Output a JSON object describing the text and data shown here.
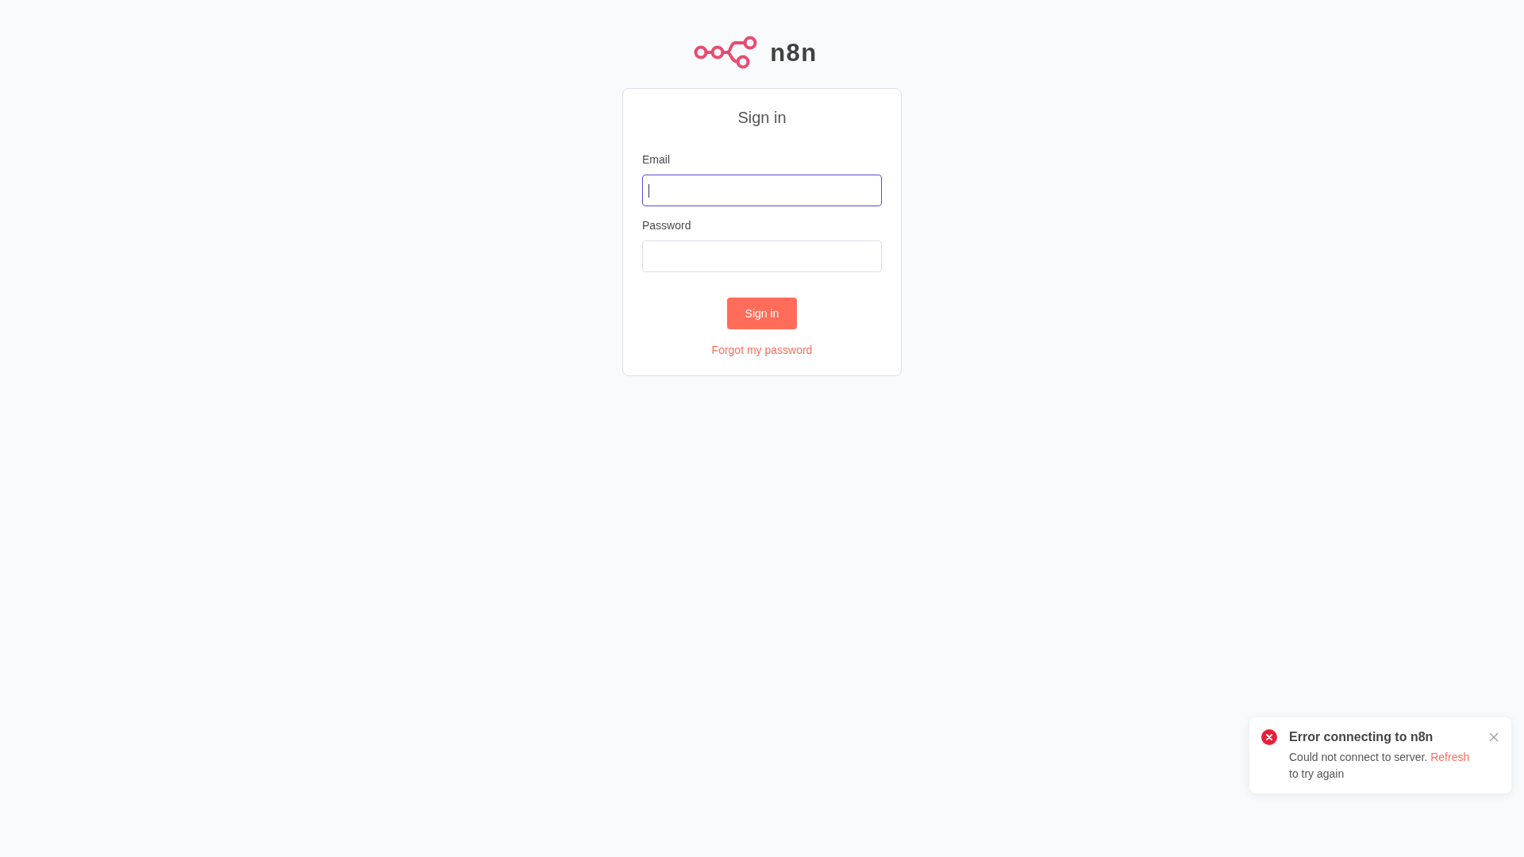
{
  "logo": {
    "wordmark": "n8n"
  },
  "sign_in": {
    "title": "Sign in",
    "fields": [
      {
        "label": "Email",
        "focused": true
      },
      {
        "label": "Password",
        "focused": false
      }
    ],
    "submit": "Sign in",
    "forgot_link": "Forgot my password"
  },
  "toast": {
    "kind": "error",
    "title": "Error connecting to n8n",
    "message_start": "Could not connect to server.",
    "link": "Refresh",
    "message_end": "to try again"
  }
}
